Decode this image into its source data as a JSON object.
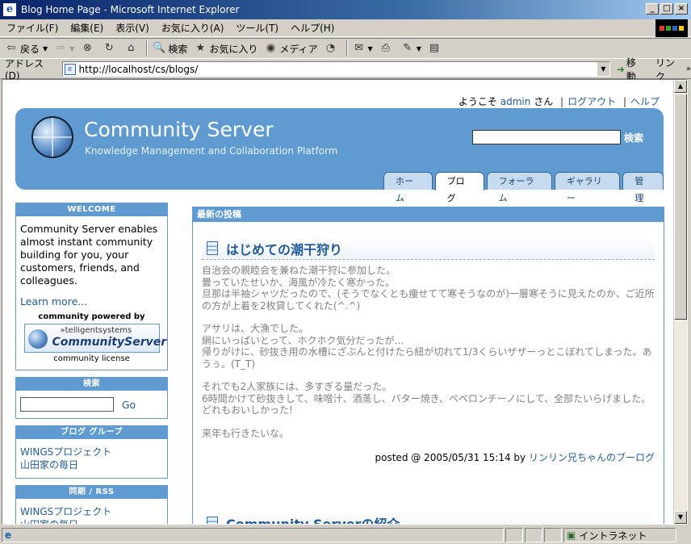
{
  "window": {
    "title": "Blog Home Page - Microsoft Internet Explorer",
    "buttons": [
      "_",
      "□",
      "×"
    ]
  },
  "menu": [
    "ファイル(F)",
    "編集(E)",
    "表示(V)",
    "お気に入り(A)",
    "ツール(T)",
    "ヘルプ(H)"
  ],
  "toolbar": {
    "back": "戻る",
    "search": "検索",
    "favorites": "お気に入り",
    "media": "メディア"
  },
  "address": {
    "label": "アドレス(D)",
    "url": "http://localhost/cs/blogs/",
    "go": "移動",
    "links": "リンク"
  },
  "status": {
    "zone": "イントラネット"
  },
  "site": {
    "welcome_prefix": "ようこそ",
    "user": "admin",
    "welcome_suffix": "さん",
    "logout": "ログアウト",
    "help": "ヘルプ",
    "title": "Community Server",
    "subtitle": "Knowledge Management and Collaboration Platform",
    "search_button": "検索",
    "tabs": [
      "ホーム",
      "ブログ",
      "フォーラム",
      "ギャラリー",
      "管理"
    ],
    "active_tab": "ブログ"
  },
  "sidebar": {
    "welcome_head": "WELCOME",
    "welcome_text": "Community Server enables almost instant community building for you, your customers, friends, and colleagues.",
    "learn_more": "Learn more...",
    "powered_by": "community powered by",
    "logo_top": "»telligentsystems",
    "logo_name": "CommunityServer",
    "license": "community license",
    "search_head": "検索",
    "search_go": "Go",
    "groups_head": "ブログ グループ",
    "groups": [
      "WINGSプロジェクト",
      "山田家の毎日"
    ],
    "rss_head": "同期 / RSS",
    "rss": [
      "WINGSプロジェクト",
      "山田家の毎日"
    ]
  },
  "main": {
    "head": "最新の投稿",
    "post_title": "はじめての潮干狩り",
    "paragraphs": [
      [
        "自治会の親睦会を兼ねた潮干狩に参加した。",
        "曇っていたせいか、海風が冷たく寒かった。",
        "旦那は半袖シャツだったので、(そうでなくとも痩せてて寒そうなのが)一層寒そうに見えたのか、ご近所の方が上着を2枚貸してくれた(^.^)"
      ],
      [
        "アサリは、大漁でした。",
        "網にいっぱいとって、ホクホク気分だったが…",
        "帰りがけに、砂抜き用の水槽にざぶんと付けたら紐が切れて1/3くらいザザーっとこぼれてしまった。あうぅ。(T_T)"
      ],
      [
        "それでも2人家族には、多すぎる量だった。",
        "6時間かけて砂抜きして、味噌汁、酒蒸し、バター焼き、ペペロンチーノにして、全部たいらげました。",
        "どれもおいしかった!"
      ],
      [
        "来年も行きたいな。"
      ]
    ],
    "posted": "posted @ 2005/05/31 15:14 by",
    "author": "リンリン兄ちゃんのブーログ",
    "next_title": "Community Serverの紹介"
  }
}
